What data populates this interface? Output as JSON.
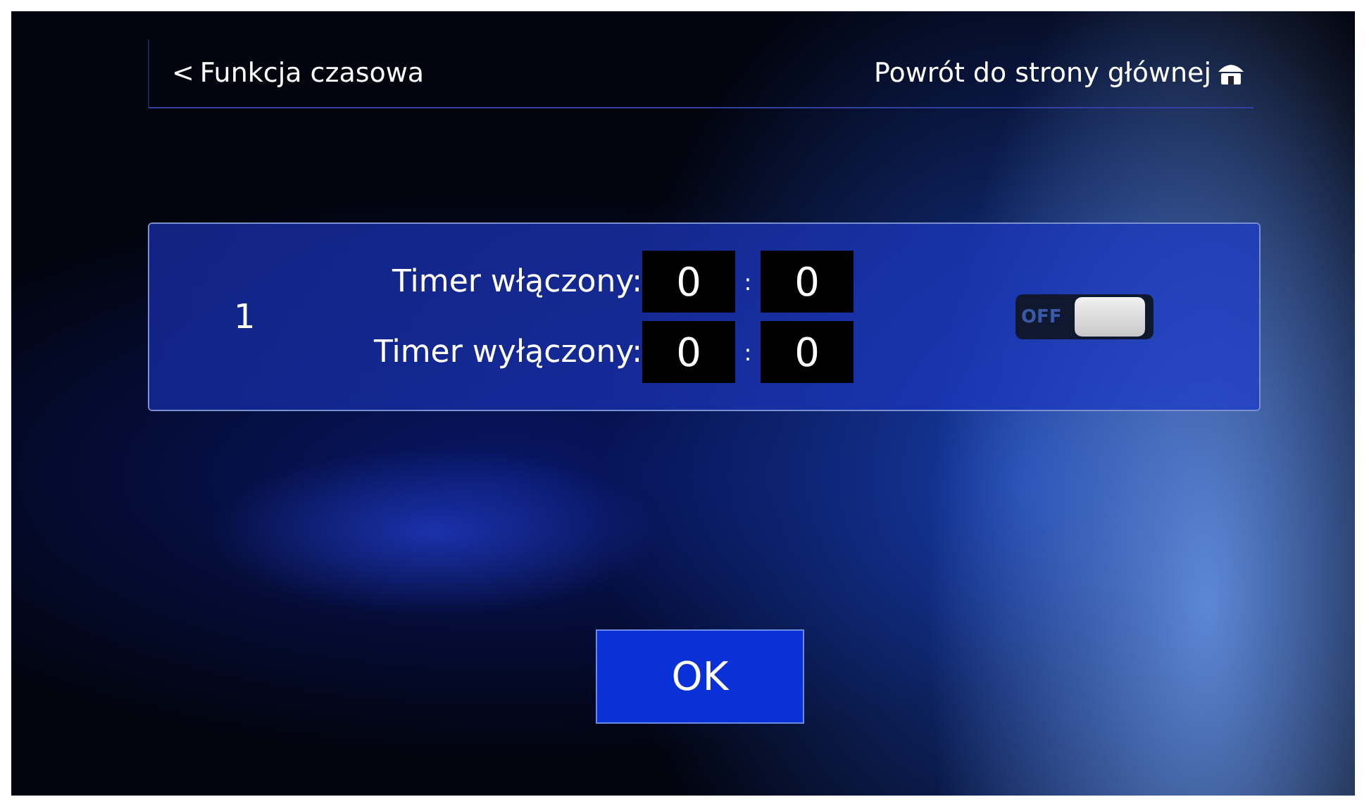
{
  "header": {
    "back_label": "Funkcja czasowa",
    "back_arrow": "<",
    "home_label": "Powrót do strony głównej"
  },
  "timers": [
    {
      "index": "1",
      "on_label": "Timer włączony:",
      "on_hour": "0",
      "on_minute": "0",
      "off_label": "Timer wyłączony:",
      "off_hour": "0",
      "off_minute": "0",
      "separator": ":",
      "toggle": {
        "on": false,
        "label": "OFF"
      }
    }
  ],
  "ok_button": "OK"
}
